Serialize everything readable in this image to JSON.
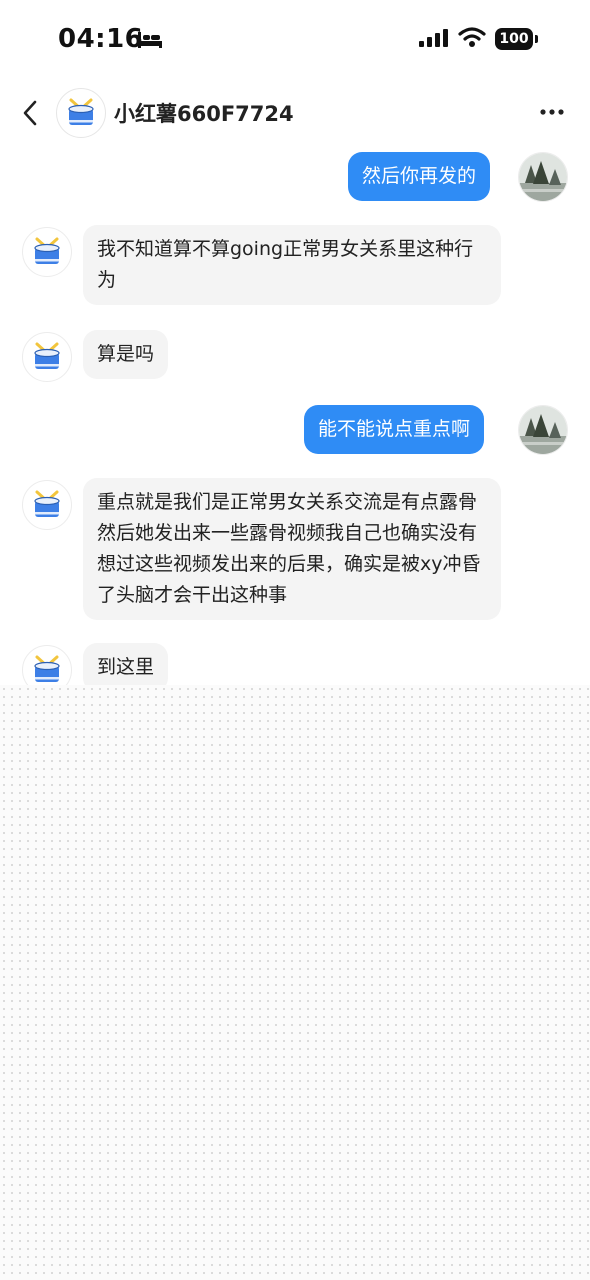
{
  "status_bar": {
    "time": "04:16",
    "battery": "100",
    "icons": [
      "bed-icon",
      "cellular-signal-icon",
      "wifi-icon",
      "battery-icon"
    ]
  },
  "nav": {
    "title": "小红薯660F7724",
    "back_icon": "chevron-left-icon",
    "more_icon": "more-dots-icon",
    "avatar_icon": "drum-icon"
  },
  "messages": [
    {
      "side": "out",
      "text": "然后你再发的"
    },
    {
      "side": "in",
      "text": "我不知道算不算going正常男女关系里这种行为"
    },
    {
      "side": "in",
      "text": "算是吗"
    },
    {
      "side": "out",
      "text": "能不能说点重点啊"
    },
    {
      "side": "in",
      "text": "重点就是我们是正常男女关系交流是有点露骨然后她发出来一些露骨视频我自己也确实没有想过这些视频发出来的后果，确实是被xy冲昏了头脑才会干出这种事"
    },
    {
      "side": "in",
      "text": "到这里"
    }
  ],
  "colors": {
    "outgoing_bubble": "#2f8cf5",
    "incoming_bubble": "#f4f4f4",
    "drum_blue": "#3d7fe6",
    "drum_stick": "#f2c53d"
  }
}
